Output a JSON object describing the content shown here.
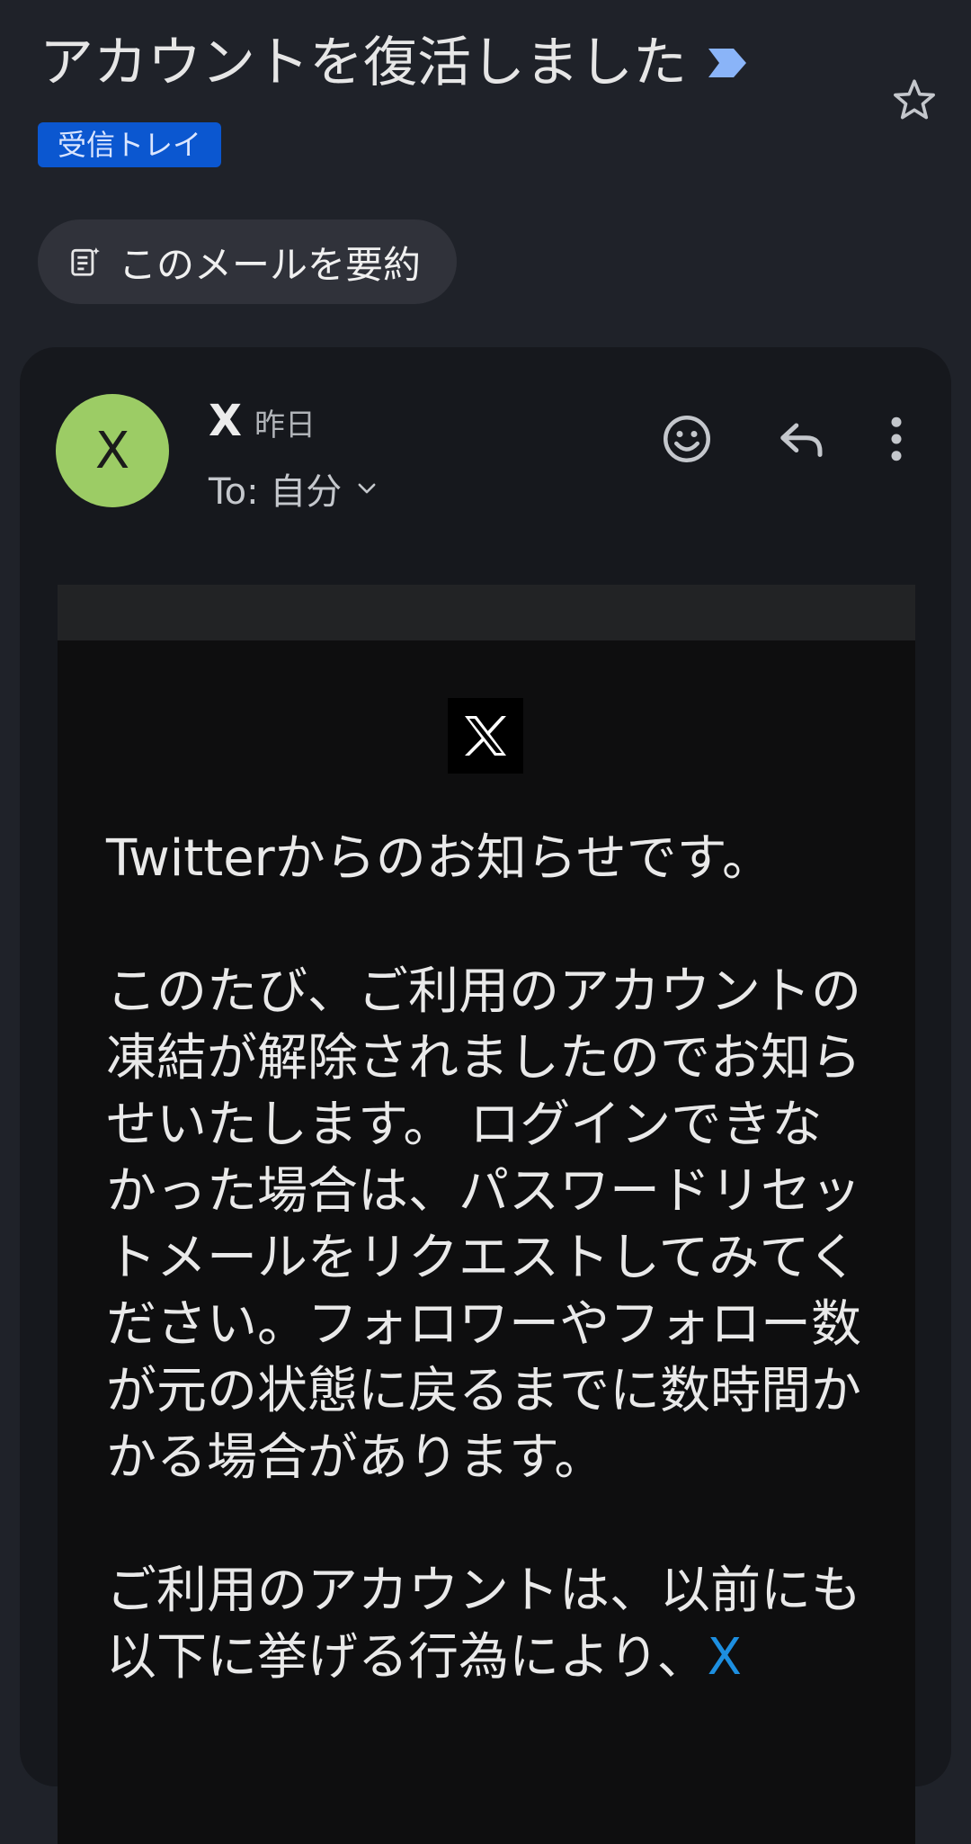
{
  "header": {
    "subject": "アカウントを復活しました",
    "label": "受信トレイ",
    "summarize_chip": "このメールを要約",
    "icons": {
      "importance": "importance-marker-icon",
      "star": "star-icon"
    },
    "colors": {
      "label_bg": "#0b57d0",
      "importance": "#8ab4f8"
    }
  },
  "message": {
    "avatar_letter": "X",
    "avatar_color": "#9ccc65",
    "sender": "X",
    "time": "昨日",
    "recipient": "To: 自分",
    "actions": [
      "emoji-reaction-icon",
      "reply-icon",
      "more-vert-icon"
    ]
  },
  "email_body": {
    "logo": "X",
    "greeting": "Twitterからのお知らせです。",
    "paragraph1": "このたび、ご利用のアカウントの凍結が解除されましたのでお知らせいたします。 ログインできなかった場合は、パスワードリセットメールをリクエストしてみてください。フォロワーやフォロー数が元の状態に戻るまでに数時間かかる場合があります。",
    "paragraph2": "ご利用のアカウントは、以前にも以下に挙げる行為により、",
    "paragraph2_link": "X",
    "link_color": "#1d8fe0"
  }
}
